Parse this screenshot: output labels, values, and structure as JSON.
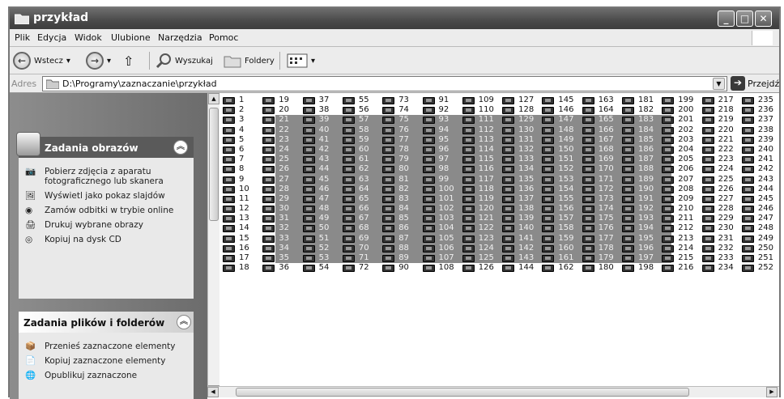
{
  "window": {
    "title": "przykład"
  },
  "menu": [
    "Plik",
    "Edycja",
    "Widok",
    "Ulubione",
    "Narzędzia",
    "Pomoc"
  ],
  "toolbar": {
    "back_label": "Wstecz",
    "search_label": "Wyszukaj",
    "folders_label": "Foldery"
  },
  "address": {
    "label": "Adres",
    "path": "D:\\Programy\\zaznaczanie\\przykład",
    "go_label": "Przejdź"
  },
  "panels": {
    "images": {
      "title": "Zadania obrazów",
      "items": [
        "Pobierz zdjęcia z aparatu fotograficznego lub skanera",
        "Wyświetl jako pokaz slajdów",
        "Zamów odbitki w trybie online",
        "Drukuj wybrane obrazy",
        "Kopiuj na dysk CD"
      ]
    },
    "files": {
      "title": "Zadania plików i folderów",
      "items": [
        "Przenieś zaznaczone elementy",
        "Kopiuj zaznaczone elementy",
        "Opublikuj zaznaczone"
      ]
    }
  },
  "files": {
    "rows_per_column": 18,
    "first": 1,
    "last": 252,
    "selection": {
      "from_column": 2,
      "to_column": 11,
      "from_row": 3,
      "to_row": 17
    }
  },
  "colors": {
    "selection": "#8a8a8a",
    "titlebar": "#4a4a4a"
  }
}
